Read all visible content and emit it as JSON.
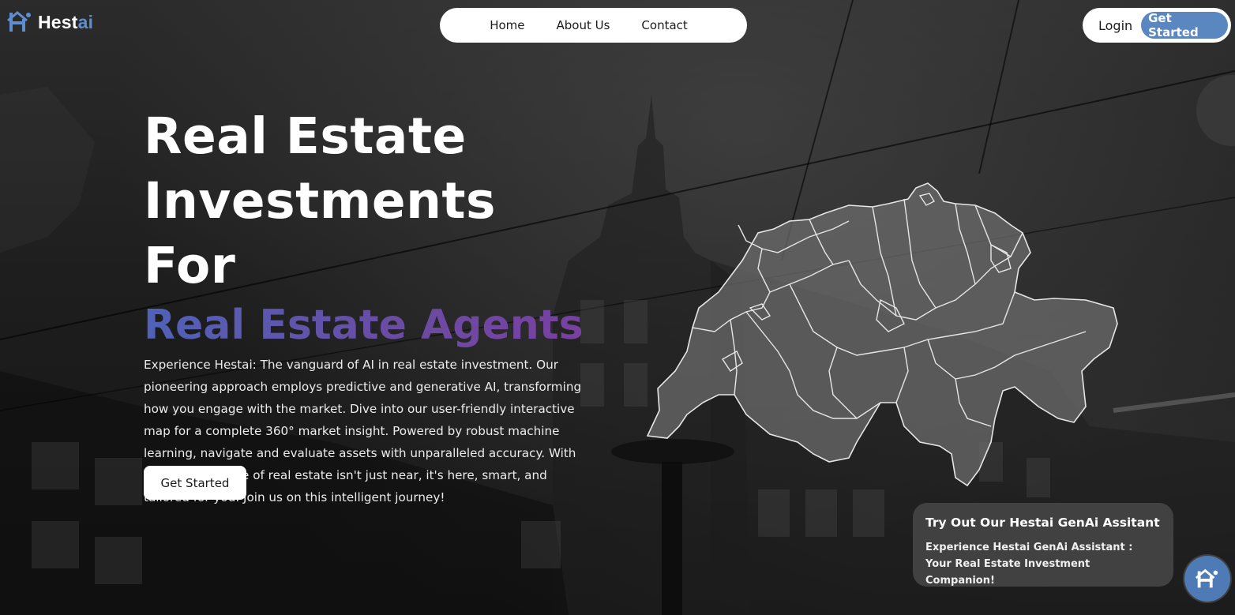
{
  "brand": {
    "name_part1": "Hest",
    "name_part2": "ai",
    "accent_color": "#5f8ed0"
  },
  "nav": {
    "items": [
      {
        "label": "Home"
      },
      {
        "label": "About Us"
      },
      {
        "label": "Contact"
      }
    ]
  },
  "auth": {
    "login_label": "Login",
    "get_started_label": "Get Started",
    "button_color": "#5a87bf"
  },
  "hero": {
    "title_line1": "Real Estate",
    "title_line2": "Investments For",
    "title_accent": "Real Estate Agents",
    "description": "Experience Hestai: The vanguard of AI in real estate investment. Our pioneering approach employs predictive and generative AI, transforming how you engage with the market. Dive into our user-friendly interactive map for a complete 360° market insight. Powered by robust machine learning, navigate and evaluate assets with unparalleled accuracy. With Hestai, the future of real estate isn't just near, it's here, smart, and tailored for you. Join us on this intelligent journey!",
    "cta_label": "Get Started",
    "accent_gradient": [
      "#4f62b8",
      "#7a3fa0"
    ]
  },
  "map": {
    "icon": "switzerland-cantons-map"
  },
  "assistant": {
    "title": "Try Out Our Hestai GenAi Assitant",
    "description": "Experience Hestai GenAi Assistant : Your Real Estate Investment Companion!",
    "fab_icon": "hestai-logo-icon"
  }
}
